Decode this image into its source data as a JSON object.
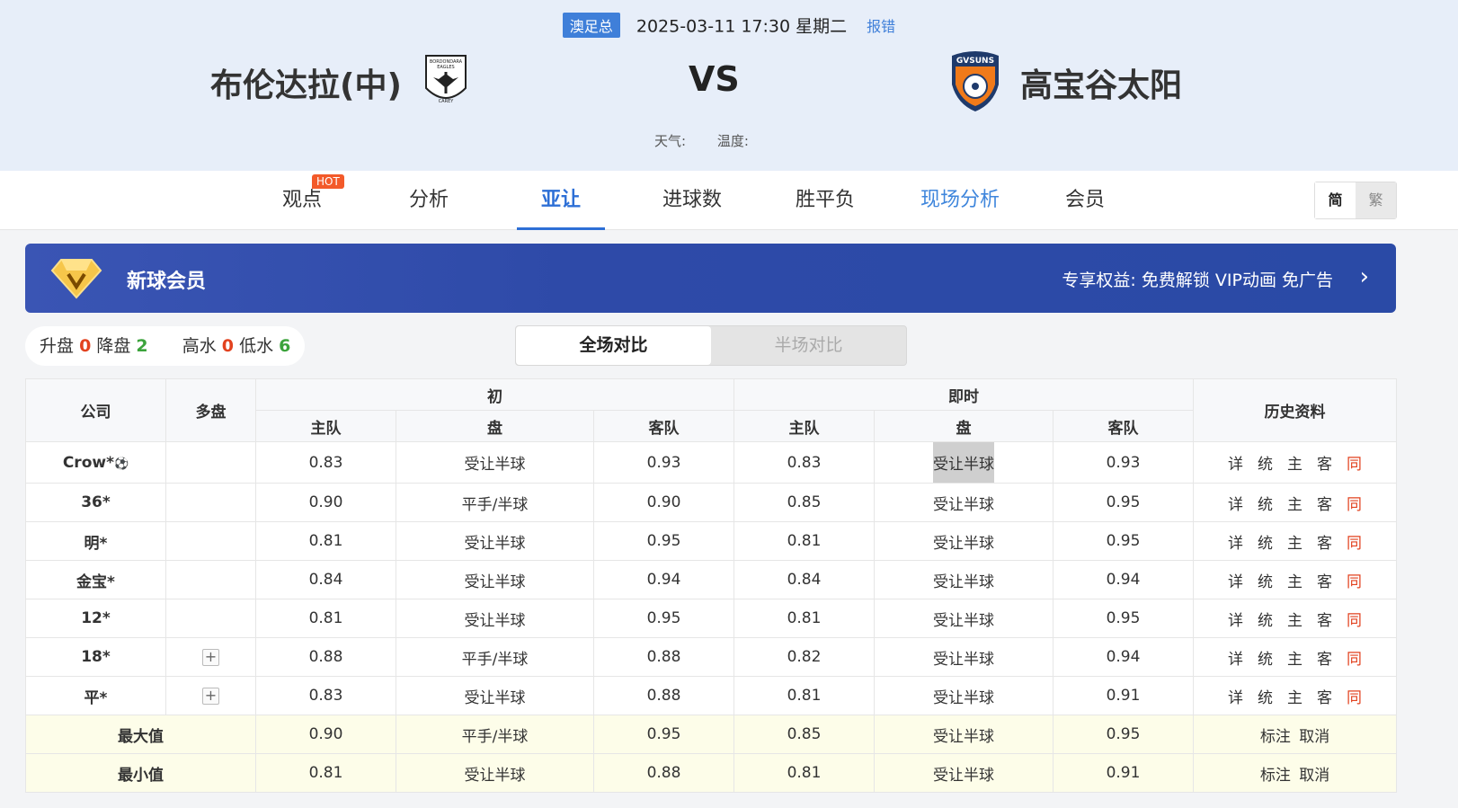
{
  "header": {
    "league": "澳足总",
    "datetime": "2025-03-11 17:30 星期二",
    "report": "报错",
    "home_team": "布伦达拉(中)",
    "away_team": "高宝谷太阳",
    "vs": "VS",
    "weather_label": "天气:",
    "temp_label": "温度:",
    "home_logo_text": [
      "BORDONDARA",
      "EAGLES",
      "CAREY"
    ],
    "away_logo_text": "GVSUNS"
  },
  "nav": {
    "items": [
      "观点",
      "分析",
      "亚让",
      "进球数",
      "胜平负",
      "现场分析",
      "会员"
    ],
    "hot": "HOT",
    "lang_simplified": "简",
    "lang_traditional": "繁"
  },
  "vip": {
    "title": "新球会员",
    "desc": "专享权益:  免费解锁 VIP动画 免广告",
    "arrow": "›"
  },
  "stats": {
    "up_label": "升盘",
    "up": "0",
    "down_label": "降盘",
    "down": "2",
    "high_label": "高水",
    "high": "0",
    "low_label": "低水",
    "low": "6"
  },
  "toggle": {
    "full": "全场对比",
    "half": "半场对比"
  },
  "table": {
    "col_company": "公司",
    "col_multi": "多盘",
    "group_initial": "初",
    "group_live": "即时",
    "col_history": "历史资料",
    "col_home": "主队",
    "col_line": "盘",
    "col_away": "客队",
    "links": [
      "详",
      "统",
      "主",
      "客",
      "同"
    ],
    "rows": [
      {
        "company": "Crow*",
        "ball": "⚽",
        "multi": "",
        "i_home": "0.83",
        "i_line": "受让半球",
        "i_away": "0.93",
        "l_home": "0.83",
        "l_line": "受让半球",
        "l_away": "0.93"
      },
      {
        "company": "36*",
        "multi": "",
        "i_home": "0.90",
        "i_line": "平手/半球",
        "i_away": "0.90",
        "l_home": "0.85",
        "l_line": "受让半球",
        "l_away": "0.95"
      },
      {
        "company": "明*",
        "multi": "",
        "i_home": "0.81",
        "i_line": "受让半球",
        "i_away": "0.95",
        "l_home": "0.81",
        "l_line": "受让半球",
        "l_away": "0.95"
      },
      {
        "company": "金宝*",
        "multi": "",
        "i_home": "0.84",
        "i_line": "受让半球",
        "i_away": "0.94",
        "l_home": "0.84",
        "l_line": "受让半球",
        "l_away": "0.94"
      },
      {
        "company": "12*",
        "multi": "",
        "i_home": "0.81",
        "i_line": "受让半球",
        "i_away": "0.95",
        "l_home": "0.81",
        "l_line": "受让半球",
        "l_away": "0.95"
      },
      {
        "company": "18*",
        "multi": "+",
        "i_home": "0.88",
        "i_line": "平手/半球",
        "i_away": "0.88",
        "l_home": "0.82",
        "l_line": "受让半球",
        "l_away": "0.94"
      },
      {
        "company": "平*",
        "multi": "+",
        "i_home": "0.83",
        "i_line": "受让半球",
        "i_away": "0.88",
        "l_home": "0.81",
        "l_line": "受让半球",
        "l_away": "0.91"
      }
    ],
    "max": {
      "label": "最大值",
      "i_home": "0.90",
      "i_line": "平手/半球",
      "i_away": "0.95",
      "l_home": "0.85",
      "l_line": "受让半球",
      "l_away": "0.95"
    },
    "min": {
      "label": "最小值",
      "i_home": "0.81",
      "i_line": "受让半球",
      "i_away": "0.88",
      "l_home": "0.81",
      "l_line": "受让半球",
      "l_away": "0.91"
    },
    "mark": "标注",
    "cancel": "取消"
  }
}
